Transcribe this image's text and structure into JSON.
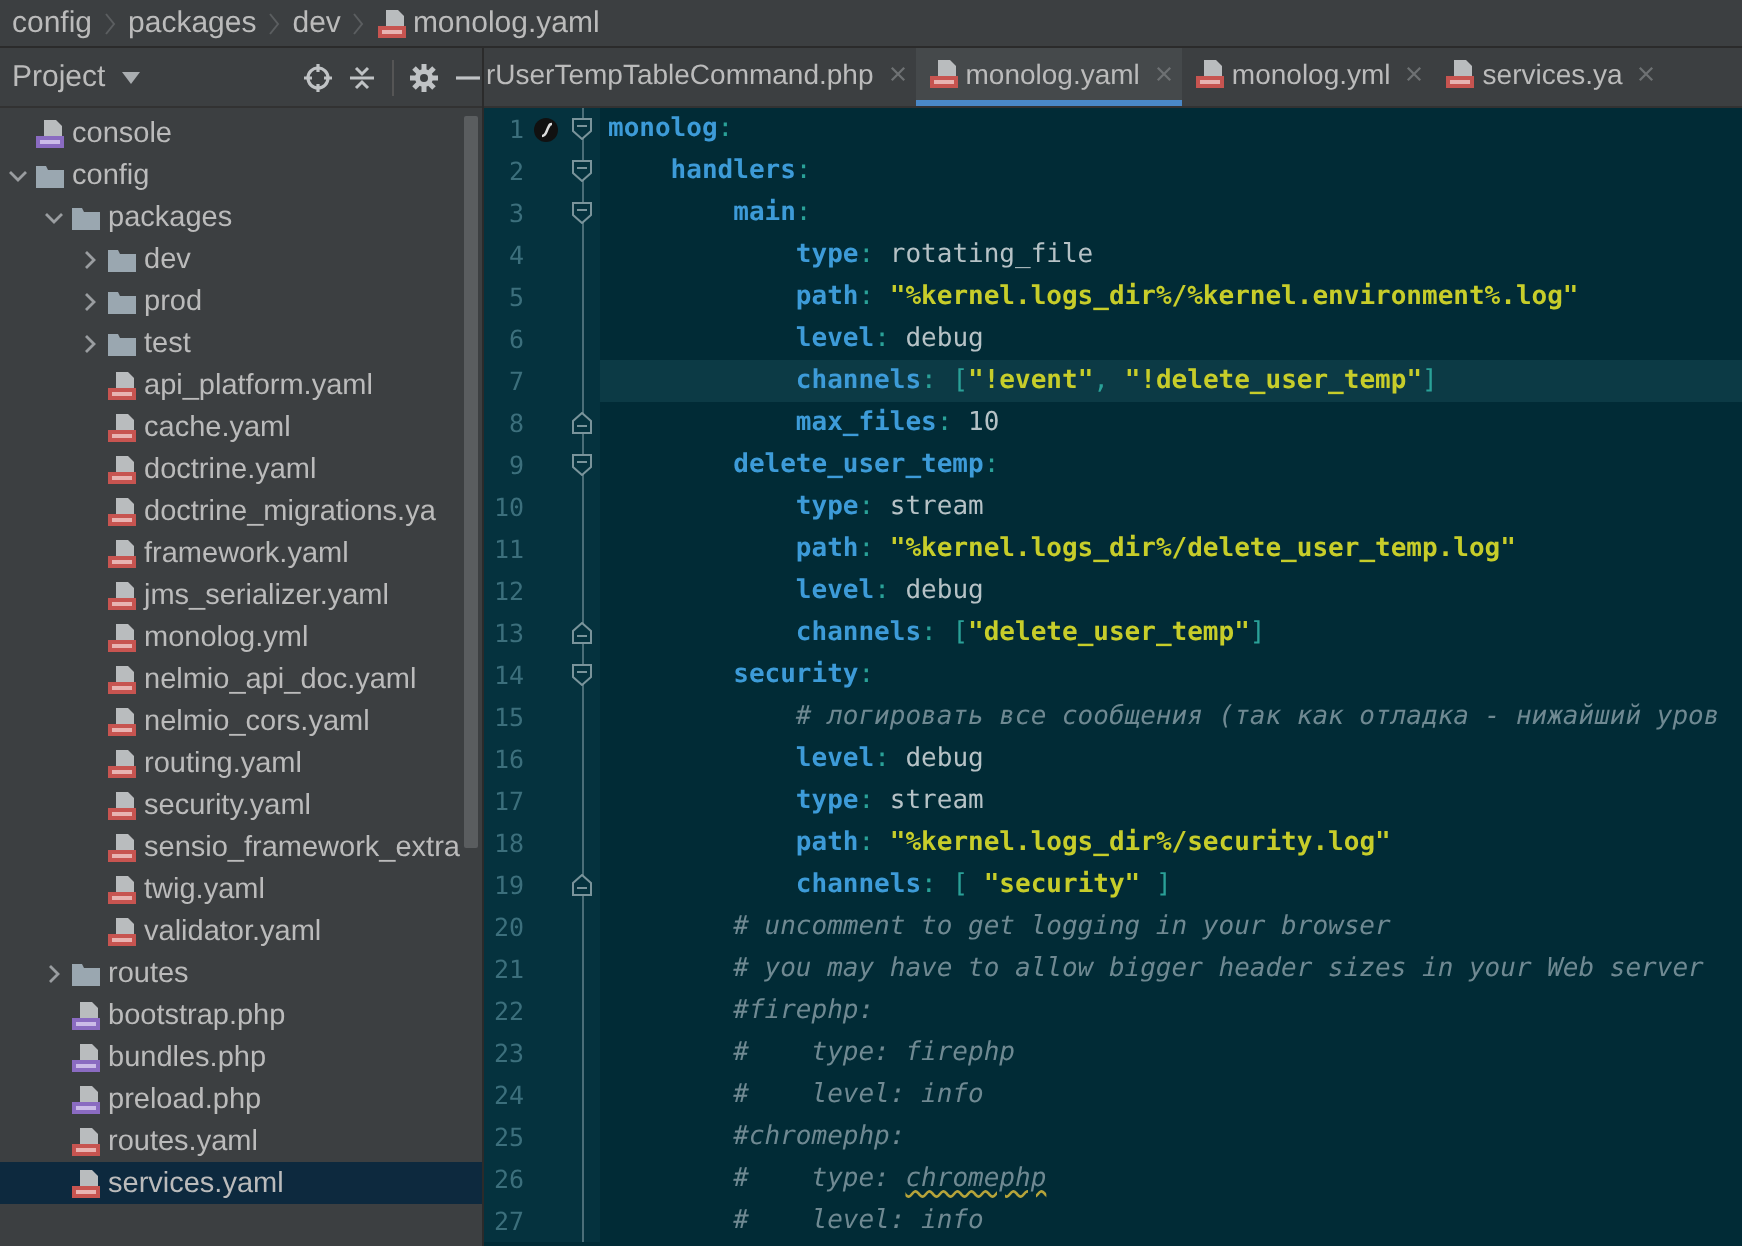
{
  "breadcrumb": [
    {
      "label": "config",
      "kind": "folder"
    },
    {
      "label": "packages",
      "kind": "folder"
    },
    {
      "label": "dev",
      "kind": "folder"
    },
    {
      "label": "monolog.yaml",
      "kind": "yml"
    }
  ],
  "project_panel": {
    "title": "Project"
  },
  "tabs": [
    {
      "label": "rUserTempTableCommand.php",
      "kind": "partial",
      "selected": false
    },
    {
      "label": "monolog.yaml",
      "kind": "yml",
      "selected": true
    },
    {
      "label": "monolog.yml",
      "kind": "yml",
      "selected": false
    },
    {
      "label": "services.ya",
      "kind": "yml",
      "selected": false
    }
  ],
  "tree": [
    {
      "name": "console",
      "kind": "php",
      "selected": false
    },
    {
      "name": "config",
      "kind": "folder",
      "expanded": true,
      "selected": false,
      "children": [
        {
          "name": "packages",
          "kind": "folder",
          "expanded": true,
          "selected": false,
          "children": [
            {
              "name": "dev",
              "kind": "folder",
              "expanded": false,
              "selected": false
            },
            {
              "name": "prod",
              "kind": "folder",
              "expanded": false,
              "selected": false
            },
            {
              "name": "test",
              "kind": "folder",
              "expanded": false,
              "selected": false
            },
            {
              "name": "api_platform.yaml",
              "kind": "yml",
              "selected": false
            },
            {
              "name": "cache.yaml",
              "kind": "yml",
              "selected": false
            },
            {
              "name": "doctrine.yaml",
              "kind": "yml",
              "selected": false
            },
            {
              "name": "doctrine_migrations.ya",
              "kind": "yml",
              "selected": false
            },
            {
              "name": "framework.yaml",
              "kind": "yml",
              "selected": false
            },
            {
              "name": "jms_serializer.yaml",
              "kind": "yml",
              "selected": false
            },
            {
              "name": "monolog.yml",
              "kind": "yml",
              "selected": false
            },
            {
              "name": "nelmio_api_doc.yaml",
              "kind": "yml",
              "selected": false
            },
            {
              "name": "nelmio_cors.yaml",
              "kind": "yml",
              "selected": false
            },
            {
              "name": "routing.yaml",
              "kind": "yml",
              "selected": false
            },
            {
              "name": "security.yaml",
              "kind": "yml",
              "selected": false
            },
            {
              "name": "sensio_framework_extra",
              "kind": "yml",
              "selected": false
            },
            {
              "name": "twig.yaml",
              "kind": "yml",
              "selected": false
            },
            {
              "name": "validator.yaml",
              "kind": "yml",
              "selected": false
            }
          ]
        },
        {
          "name": "routes",
          "kind": "folder",
          "expanded": false,
          "selected": false
        },
        {
          "name": "bootstrap.php",
          "kind": "php",
          "selected": false
        },
        {
          "name": "bundles.php",
          "kind": "php",
          "selected": false
        },
        {
          "name": "preload.php",
          "kind": "php",
          "selected": false
        },
        {
          "name": "routes.yaml",
          "kind": "yml",
          "selected": false
        },
        {
          "name": "services.yaml",
          "kind": "yml",
          "selected": true
        }
      ]
    }
  ],
  "editor": {
    "lines": [
      {
        "number": "1",
        "current": false,
        "kind": "fold_start",
        "tokens": [
          {
            "kind": "key",
            "text": "monolog"
          },
          {
            "kind": "punct",
            "text": ":"
          }
        ]
      },
      {
        "number": "2",
        "current": false,
        "kind": "fold_start",
        "tokens": [
          {
            "kind": "key",
            "text": "    handlers"
          },
          {
            "kind": "punct",
            "text": ":"
          }
        ]
      },
      {
        "number": "3",
        "current": false,
        "kind": "fold_start",
        "tokens": [
          {
            "kind": "key",
            "text": "        main"
          },
          {
            "kind": "punct",
            "text": ":"
          }
        ]
      },
      {
        "number": "4",
        "current": false,
        "kind": "plain",
        "tokens": [
          {
            "kind": "key",
            "text": "            type"
          },
          {
            "kind": "punct",
            "text": ": "
          },
          {
            "kind": "value",
            "text": "rotating_file"
          }
        ]
      },
      {
        "number": "5",
        "current": false,
        "kind": "plain",
        "tokens": [
          {
            "kind": "key",
            "text": "            path"
          },
          {
            "kind": "punct",
            "text": ": "
          },
          {
            "kind": "string",
            "text": "\"%kernel.logs_dir%/%kernel.environment%.log\""
          }
        ]
      },
      {
        "number": "6",
        "current": false,
        "kind": "plain",
        "tokens": [
          {
            "kind": "key",
            "text": "            level"
          },
          {
            "kind": "punct",
            "text": ": "
          },
          {
            "kind": "value",
            "text": "debug"
          }
        ]
      },
      {
        "number": "7",
        "current": true,
        "kind": "plain",
        "tokens": [
          {
            "kind": "key",
            "text": "            channels"
          },
          {
            "kind": "punct",
            "text": ": ["
          },
          {
            "kind": "string",
            "text": "\"!event\""
          },
          {
            "kind": "punct",
            "text": ", "
          },
          {
            "kind": "string",
            "text": "\"!delete_user_temp\""
          },
          {
            "kind": "punct",
            "text": "]"
          }
        ]
      },
      {
        "number": "8",
        "current": false,
        "kind": "fold_end",
        "tokens": [
          {
            "kind": "key",
            "text": "            max_files"
          },
          {
            "kind": "punct",
            "text": ": "
          },
          {
            "kind": "value",
            "text": "10"
          }
        ]
      },
      {
        "number": "9",
        "current": false,
        "kind": "fold_start",
        "tokens": [
          {
            "kind": "key",
            "text": "        delete_user_temp"
          },
          {
            "kind": "punct",
            "text": ":"
          }
        ]
      },
      {
        "number": "10",
        "current": false,
        "kind": "plain",
        "tokens": [
          {
            "kind": "key",
            "text": "            type"
          },
          {
            "kind": "punct",
            "text": ": "
          },
          {
            "kind": "value",
            "text": "stream"
          }
        ]
      },
      {
        "number": "11",
        "current": false,
        "kind": "plain",
        "tokens": [
          {
            "kind": "key",
            "text": "            path"
          },
          {
            "kind": "punct",
            "text": ": "
          },
          {
            "kind": "string",
            "text": "\"%kernel.logs_dir%/delete_user_temp.log\""
          }
        ]
      },
      {
        "number": "12",
        "current": false,
        "kind": "plain",
        "tokens": [
          {
            "kind": "key",
            "text": "            level"
          },
          {
            "kind": "punct",
            "text": ": "
          },
          {
            "kind": "value",
            "text": "debug"
          }
        ]
      },
      {
        "number": "13",
        "current": false,
        "kind": "fold_end",
        "tokens": [
          {
            "kind": "key",
            "text": "            channels"
          },
          {
            "kind": "punct",
            "text": ": ["
          },
          {
            "kind": "string",
            "text": "\"delete_user_temp\""
          },
          {
            "kind": "punct",
            "text": "]"
          }
        ]
      },
      {
        "number": "14",
        "current": false,
        "kind": "fold_start",
        "tokens": [
          {
            "kind": "key",
            "text": "        security"
          },
          {
            "kind": "punct",
            "text": ":"
          }
        ]
      },
      {
        "number": "15",
        "current": false,
        "kind": "plain",
        "tokens": [
          {
            "kind": "comment",
            "text": "            # логировать все сообщения (так как отладка - нижайший уров"
          }
        ]
      },
      {
        "number": "16",
        "current": false,
        "kind": "plain",
        "tokens": [
          {
            "kind": "key",
            "text": "            level"
          },
          {
            "kind": "punct",
            "text": ": "
          },
          {
            "kind": "value",
            "text": "debug"
          }
        ]
      },
      {
        "number": "17",
        "current": false,
        "kind": "plain",
        "tokens": [
          {
            "kind": "key",
            "text": "            type"
          },
          {
            "kind": "punct",
            "text": ": "
          },
          {
            "kind": "value",
            "text": "stream"
          }
        ]
      },
      {
        "number": "18",
        "current": false,
        "kind": "plain",
        "tokens": [
          {
            "kind": "key",
            "text": "            path"
          },
          {
            "kind": "punct",
            "text": ": "
          },
          {
            "kind": "string",
            "text": "\"%kernel.logs_dir%/security.log\""
          }
        ]
      },
      {
        "number": "19",
        "current": false,
        "kind": "fold_end",
        "tokens": [
          {
            "kind": "key",
            "text": "            channels"
          },
          {
            "kind": "punct",
            "text": ": [ "
          },
          {
            "kind": "string",
            "text": "\"security\""
          },
          {
            "kind": "punct",
            "text": " ]"
          }
        ]
      },
      {
        "number": "20",
        "current": false,
        "kind": "plain",
        "tokens": [
          {
            "kind": "comment",
            "text": "        # uncomment to get logging in your browser"
          }
        ]
      },
      {
        "number": "21",
        "current": false,
        "kind": "plain",
        "tokens": [
          {
            "kind": "comment",
            "text": "        # you may have to allow bigger header sizes in your Web server"
          }
        ]
      },
      {
        "number": "22",
        "current": false,
        "kind": "plain",
        "tokens": [
          {
            "kind": "comment",
            "text": "        #firephp:"
          }
        ]
      },
      {
        "number": "23",
        "current": false,
        "kind": "plain",
        "tokens": [
          {
            "kind": "comment",
            "text": "        #    type: firephp"
          }
        ]
      },
      {
        "number": "24",
        "current": false,
        "kind": "plain",
        "tokens": [
          {
            "kind": "comment",
            "text": "        #    level: info"
          }
        ]
      },
      {
        "number": "25",
        "current": false,
        "kind": "plain",
        "tokens": [
          {
            "kind": "comment",
            "text": "        #chromephp:"
          }
        ]
      },
      {
        "number": "26",
        "current": false,
        "kind": "plain",
        "tokens": [
          {
            "kind": "comment",
            "text": "        #    type: "
          },
          {
            "kind": "typo",
            "text": "chromephp"
          }
        ]
      },
      {
        "number": "27",
        "current": false,
        "kind": "plain",
        "tokens": [
          {
            "kind": "comment",
            "text": "        #    level: info"
          }
        ]
      }
    ]
  }
}
